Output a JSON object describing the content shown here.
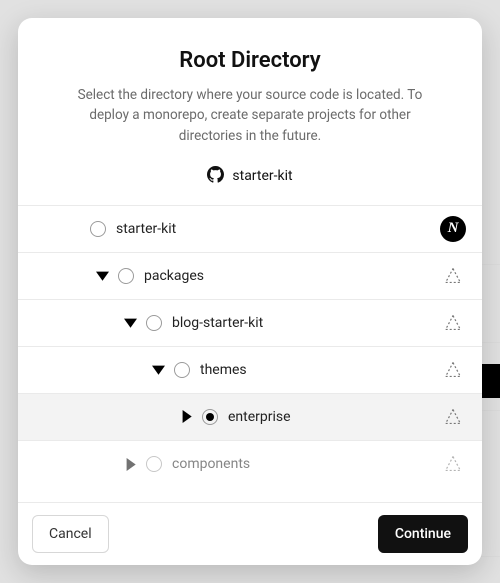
{
  "header": {
    "title": "Root Directory",
    "subtitle": "Select the directory where your source code is located. To deploy a monorepo, create separate projects for other directories in the future.",
    "repo_name": "starter-kit"
  },
  "tree": [
    {
      "label": "starter-kit",
      "depth": 0,
      "expanded": null,
      "selected": false,
      "framework": "nextjs",
      "faded": false
    },
    {
      "label": "packages",
      "depth": 1,
      "expanded": true,
      "selected": false,
      "framework": "unknown",
      "faded": false
    },
    {
      "label": "blog-starter-kit",
      "depth": 2,
      "expanded": true,
      "selected": false,
      "framework": "unknown",
      "faded": false
    },
    {
      "label": "themes",
      "depth": 3,
      "expanded": true,
      "selected": false,
      "framework": "unknown",
      "faded": false
    },
    {
      "label": "enterprise",
      "depth": 4,
      "expanded": false,
      "selected": true,
      "framework": "unknown",
      "faded": false
    },
    {
      "label": "components",
      "depth": 2,
      "expanded": false,
      "selected": false,
      "framework": "unknown",
      "faded": true
    }
  ],
  "footer": {
    "cancel_label": "Cancel",
    "continue_label": "Continue"
  }
}
